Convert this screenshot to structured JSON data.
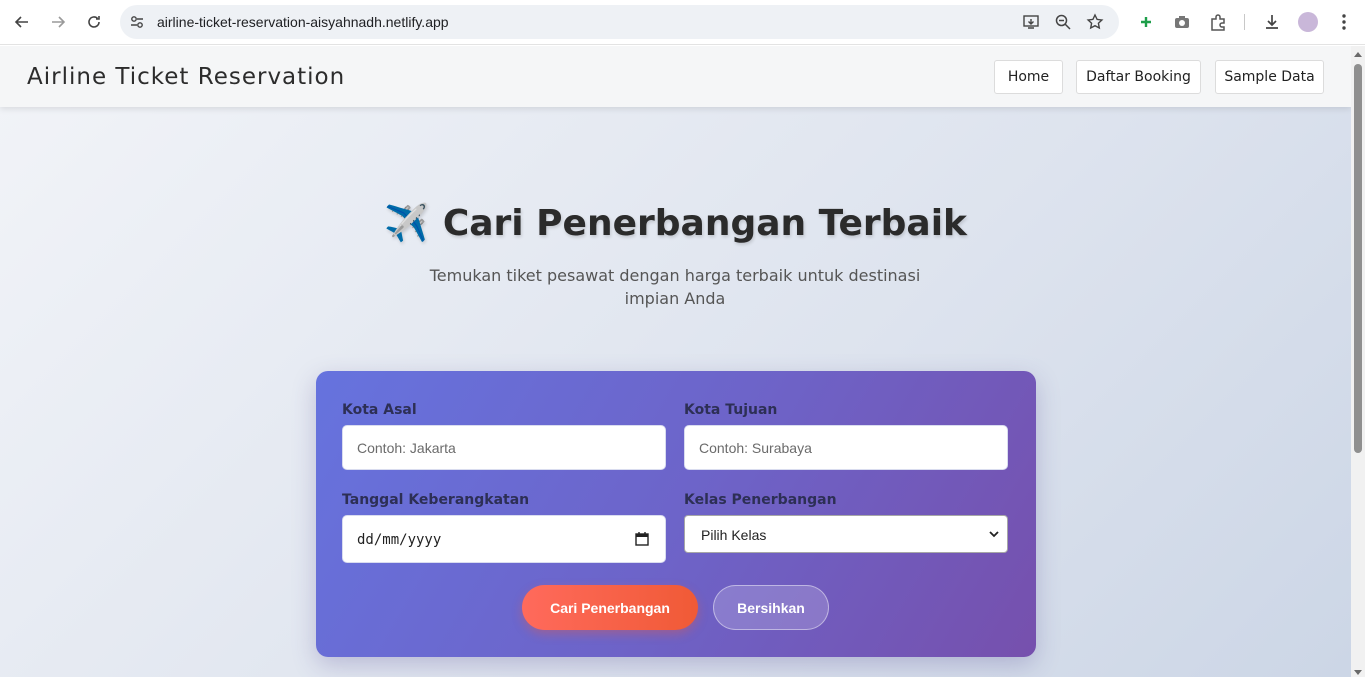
{
  "browser": {
    "url": "airline-ticket-reservation-aisyahnadh.netlify.app"
  },
  "header": {
    "brand": "Airline Ticket Reservation",
    "nav": [
      {
        "label": "Home"
      },
      {
        "label": "Daftar Booking"
      },
      {
        "label": "Sample Data"
      }
    ]
  },
  "hero": {
    "icon": "✈️",
    "title": "Cari Penerbangan Terbaik",
    "subtitle": "Temukan tiket pesawat dengan harga terbaik untuk destinasi impian Anda"
  },
  "form": {
    "origin": {
      "label": "Kota Asal",
      "placeholder": "Contoh: Jakarta",
      "value": ""
    },
    "destination": {
      "label": "Kota Tujuan",
      "placeholder": "Contoh: Surabaya",
      "value": ""
    },
    "date": {
      "label": "Tanggal Keberangkatan",
      "display": "dd/mm/yyyy"
    },
    "class": {
      "label": "Kelas Penerbangan",
      "selected": "Pilih Kelas"
    },
    "search_button": "Cari Penerbangan",
    "clear_button": "Bersihkan"
  },
  "colors": {
    "card_start": "#6673de",
    "card_end": "#7650ad",
    "primary_button": "#f05a36"
  }
}
